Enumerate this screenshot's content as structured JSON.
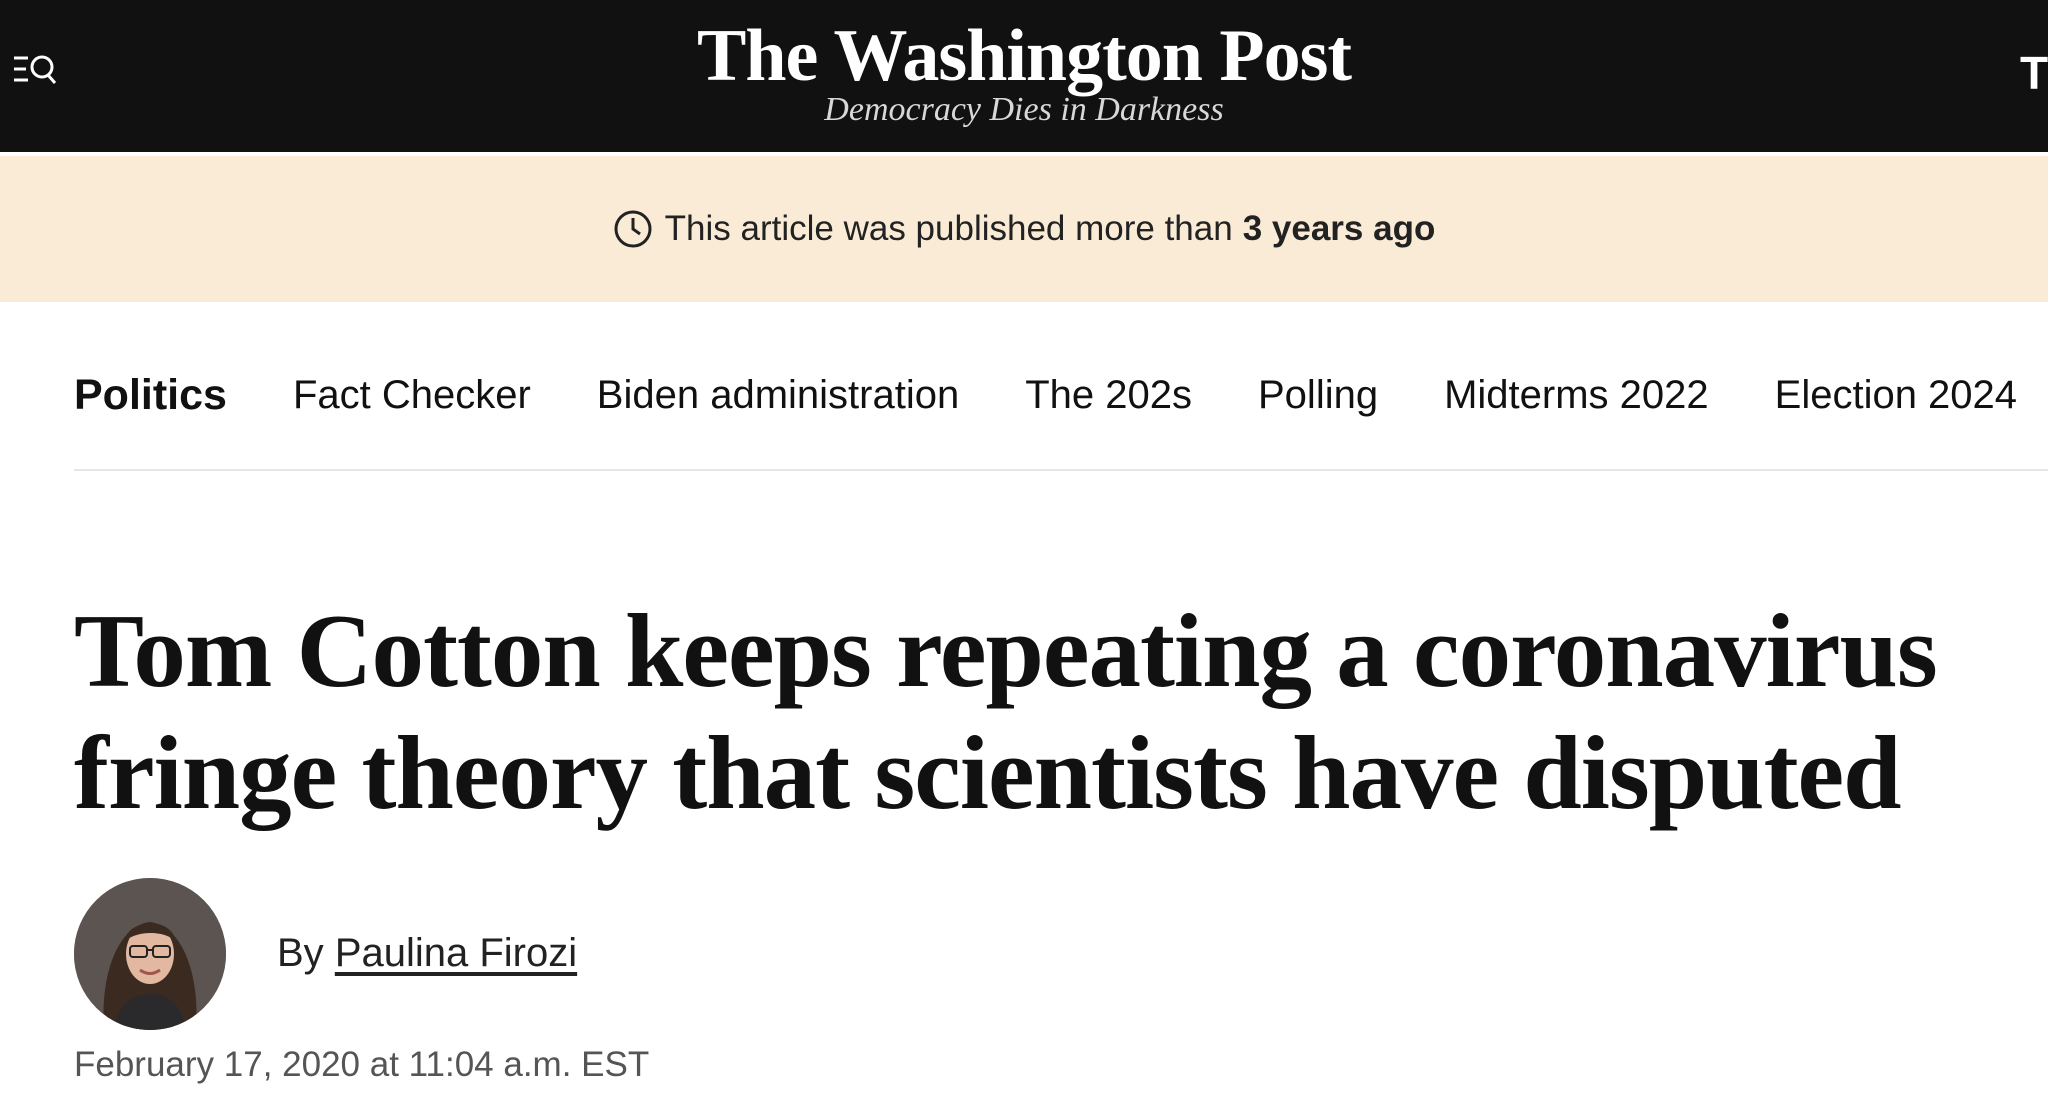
{
  "masthead": {
    "logo": "The Washington Post",
    "tagline": "Democracy Dies in Darkness",
    "right_text": "T",
    "menu_icon": "menu-search-icon"
  },
  "banner": {
    "icon": "clock-icon",
    "text": "This article was published more than",
    "emphasis": "3 years ago",
    "background": "#f9ebd5"
  },
  "subnav": {
    "items": [
      {
        "label": "Politics"
      },
      {
        "label": "Fact Checker"
      },
      {
        "label": "Biden administration"
      },
      {
        "label": "The 202s"
      },
      {
        "label": "Polling"
      },
      {
        "label": "Midterms 2022"
      },
      {
        "label": "Election 2024"
      }
    ]
  },
  "article": {
    "headline": "Tom Cotton keeps repeating a coronavirus fringe theory that scientists have disputed",
    "byline_prefix": "By",
    "author": "Paulina Firozi",
    "timestamp": "February 17, 2020 at 11:04 a.m. EST"
  },
  "colors": {
    "masthead_bg": "#111111",
    "banner_bg": "#f9ebd5",
    "text": "#111111",
    "muted": "#555555"
  }
}
